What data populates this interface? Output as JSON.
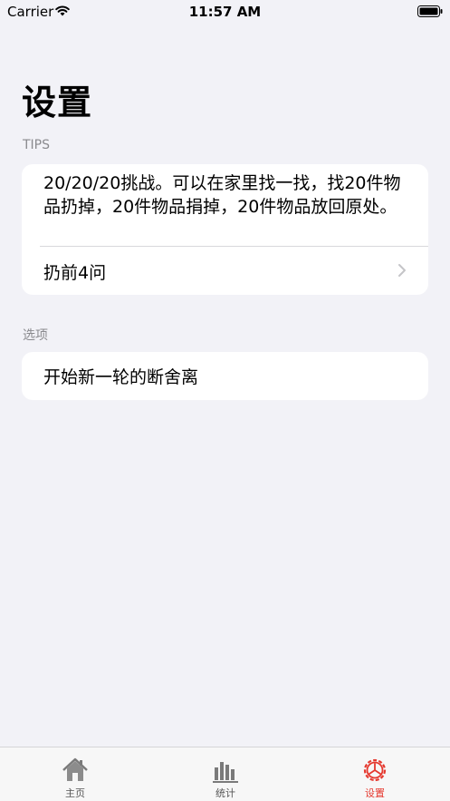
{
  "status_bar": {
    "carrier": "Carrier",
    "time": "11:57 AM"
  },
  "page": {
    "title": "设置"
  },
  "tips": {
    "header": "TIPS",
    "text": "20/20/20挑战。可以在家里找一找，找20件物品扔掉，20件物品捐掉，20件物品放回原处。",
    "row_label": "扔前4问"
  },
  "options": {
    "header": "选项",
    "row_label": "开始新一轮的断舍离"
  },
  "tab_bar": {
    "tabs": [
      {
        "label": "主页",
        "icon": "house-icon",
        "selected": false
      },
      {
        "label": "统计",
        "icon": "bar-chart-icon",
        "selected": false
      },
      {
        "label": "设置",
        "icon": "gear-icon",
        "selected": true
      }
    ],
    "selected_color": "#e5392f",
    "unselected_color": "#7a7a7a"
  }
}
